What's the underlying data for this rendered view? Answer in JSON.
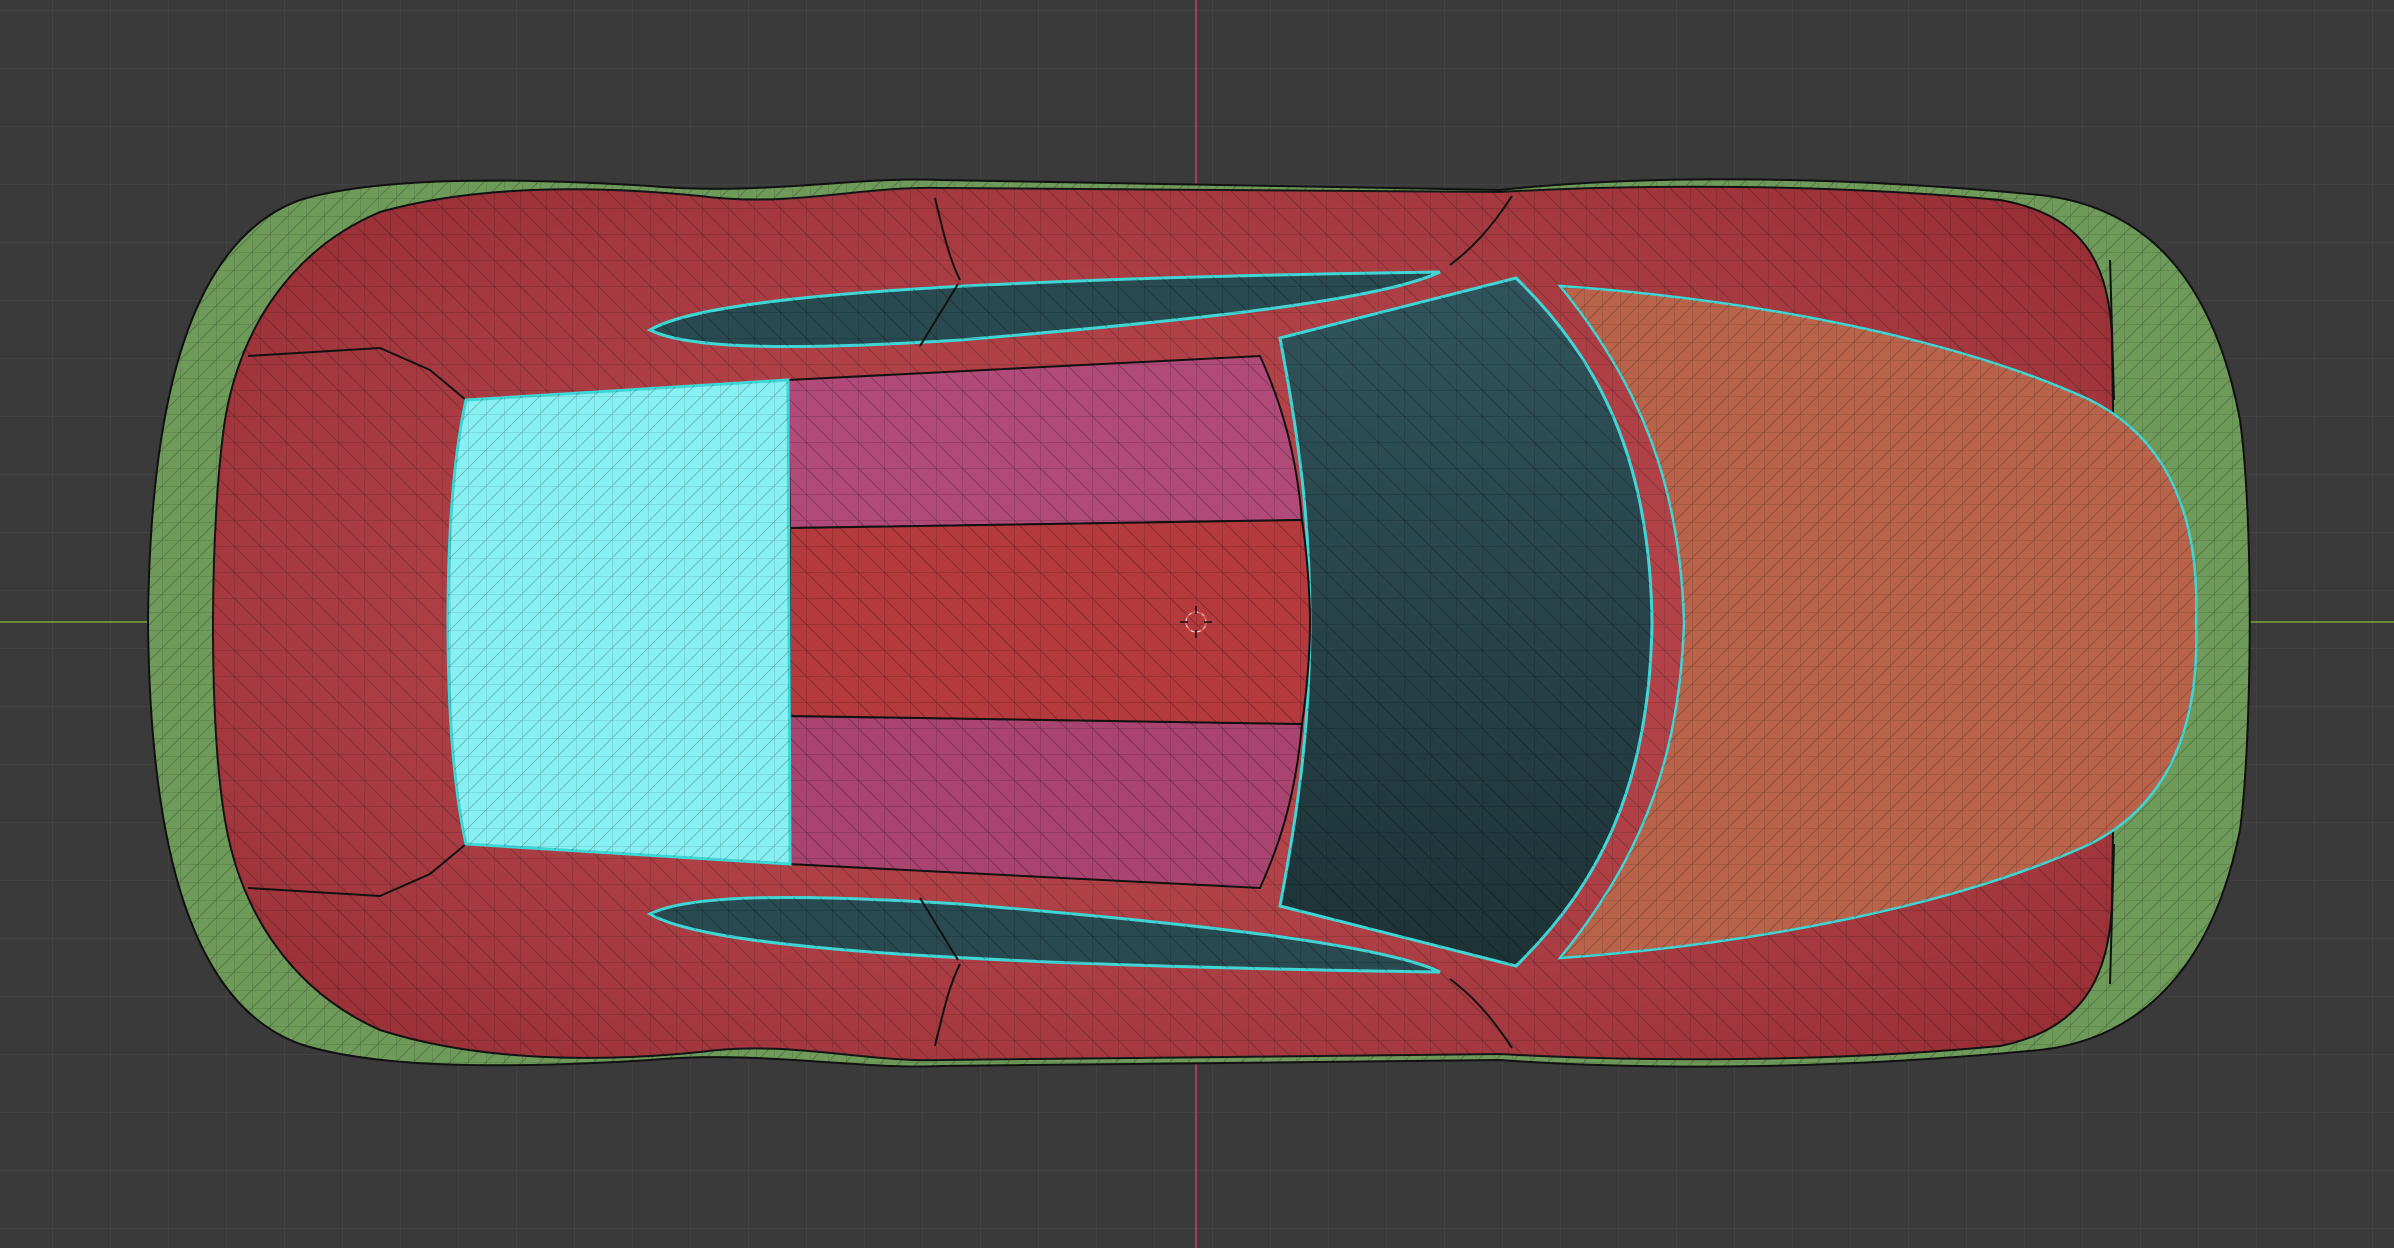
{
  "viewport": {
    "view": "top-orthographic",
    "background_color": "#3a3a3a",
    "grid_color": "#454545",
    "x_axis_color": "#6b8a3a",
    "y_axis_color": "#a04060",
    "cursor_color": "#e05a4a"
  },
  "model": {
    "object": "car-body",
    "icon": "3d-cursor-icon",
    "selection_outline_color": "#3fd6d6",
    "wireframe_color": "#000000",
    "face_groups": [
      {
        "part": "bumpers",
        "color": "#6e9a5a"
      },
      {
        "part": "body",
        "color": "#b5363d"
      },
      {
        "part": "hood",
        "color": "#b8634a"
      },
      {
        "part": "windshield",
        "color": "#2a4a52"
      },
      {
        "part": "roof-side-panels",
        "color": "#b04a78"
      },
      {
        "part": "roof-center",
        "color": "#b43a3e"
      },
      {
        "part": "rear-window",
        "color": "#88f0f2"
      },
      {
        "part": "side-windows",
        "color": "#284a50"
      }
    ]
  }
}
